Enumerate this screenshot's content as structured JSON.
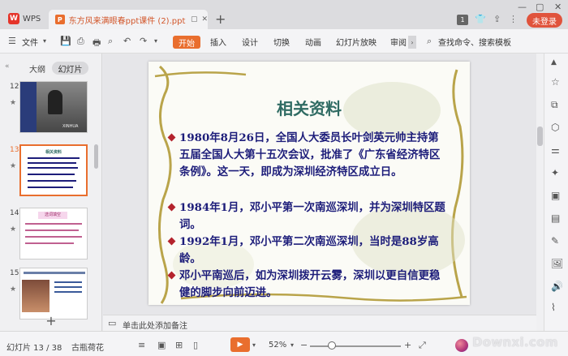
{
  "titlebar": {
    "app_name": "WPS",
    "doc_title": "东方风来满眼春ppt课件 (2).ppt",
    "new_tab": "+",
    "badge": "1",
    "login_label": "未登录"
  },
  "menubar": {
    "file": "文件",
    "items": [
      "开始",
      "插入",
      "设计",
      "切换",
      "动画",
      "幻灯片放映",
      "审阅"
    ],
    "search": "查找命令、搜索模板"
  },
  "leftpanel": {
    "tab_outline": "大纲",
    "tab_slides": "幻灯片",
    "thumbs": [
      {
        "num": "12",
        "caption": "XINHUA"
      },
      {
        "num": "13",
        "caption": "相关资料"
      },
      {
        "num": "14",
        "caption": "选词填空"
      },
      {
        "num": "15",
        "caption": ""
      }
    ],
    "add": "+"
  },
  "slide": {
    "title": "相关资料",
    "bullets": [
      "1980年8月26日，全国人大委员长叶剑英元帅主持第五届全国人大第十五次会议，批准了《广东省经济特区条例》。这一天，即成为深圳经济特区成立日。",
      "1984年1月，邓小平第一次南巡深圳，并为深圳特区题词。",
      "1992年1月，邓小平第二次南巡深圳，当时是88岁高龄。",
      "邓小平南巡后，如为深圳拨开云雾，深圳以更自信更稳健的脚步向前迈进。"
    ]
  },
  "notes": {
    "placeholder": "单击此处添加备注"
  },
  "statusbar": {
    "slide_info": "幻灯片 13 / 38",
    "theme": "古瓶荷花",
    "zoom": "52%",
    "zoom_level": 0.52,
    "minus": "−",
    "plus": "+",
    "watermark": "Downxi.com"
  },
  "colors": {
    "accent": "#e96e2e",
    "login": "#e0533c",
    "slide_title": "#2f6b63",
    "slide_text": "#1d1d7a",
    "bullet": "#b4232d"
  }
}
